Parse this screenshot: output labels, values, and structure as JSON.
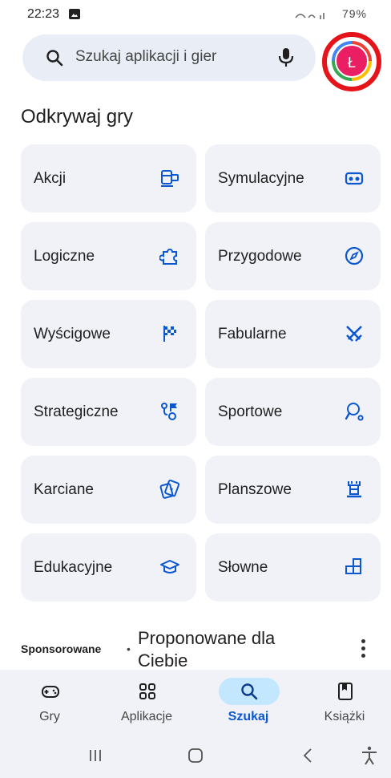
{
  "status_bar": {
    "time": "22:23",
    "right": "79%"
  },
  "search": {
    "placeholder": "Szukaj aplikacji i gier"
  },
  "avatar": {
    "initial": "Ł"
  },
  "section_title": "Odkrywaj gry",
  "categories": [
    {
      "label": "Akcji",
      "icon": "action-icon"
    },
    {
      "label": "Symulacyjne",
      "icon": "vr-headset-icon"
    },
    {
      "label": "Logiczne",
      "icon": "puzzle-icon"
    },
    {
      "label": "Przygodowe",
      "icon": "compass-icon"
    },
    {
      "label": "Wyścigowe",
      "icon": "checkered-flag-icon"
    },
    {
      "label": "Fabularne",
      "icon": "crossed-swords-icon"
    },
    {
      "label": "Strategiczne",
      "icon": "strategy-icon"
    },
    {
      "label": "Sportowe",
      "icon": "sports-icon"
    },
    {
      "label": "Karciane",
      "icon": "cards-icon"
    },
    {
      "label": "Planszowe",
      "icon": "chess-rook-icon"
    },
    {
      "label": "Edukacyjne",
      "icon": "graduation-cap-icon"
    },
    {
      "label": "Słowne",
      "icon": "word-tiles-icon"
    }
  ],
  "sponsored": {
    "label": "Sponsorowane",
    "dot": "•",
    "title": "Proponowane dla Ciebie"
  },
  "bottom_nav": {
    "items": [
      {
        "label": "Gry",
        "icon": "gamepad-icon",
        "active": false
      },
      {
        "label": "Aplikacje",
        "icon": "apps-grid-icon",
        "active": false
      },
      {
        "label": "Szukaj",
        "icon": "search-icon",
        "active": true
      },
      {
        "label": "Książki",
        "icon": "bookmark-book-icon",
        "active": false
      }
    ]
  },
  "colors": {
    "accent": "#0b57d0",
    "tile_bg": "#f0f2f7",
    "search_bg": "#e9eef6",
    "active_pill": "#c2e7ff",
    "highlight_ring": "#e5141b"
  }
}
